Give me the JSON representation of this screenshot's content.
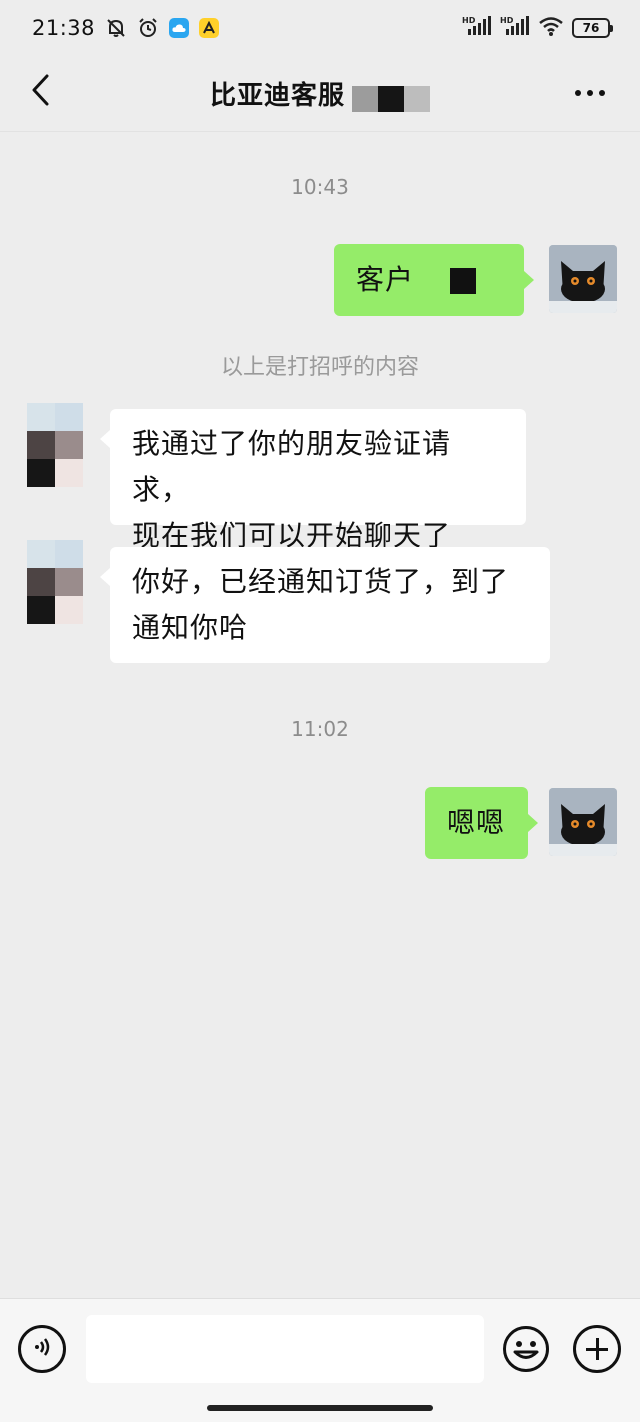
{
  "status_bar": {
    "time": "21:38",
    "left_icons": [
      "mute-bell-icon",
      "alarm-icon",
      "cloud-app-icon",
      "yellow-app-icon"
    ],
    "right_icons": [
      "hd-signal-1-icon",
      "hd-signal-2-icon",
      "wifi-icon"
    ],
    "battery": "76"
  },
  "nav": {
    "title": "比亚迪客服",
    "back_icon": "chevron-left-icon",
    "more_icon": "more-dots-icon"
  },
  "messages": [
    {
      "type": "timestamp",
      "text": "10:43"
    },
    {
      "type": "outgoing",
      "text": "客户"
    },
    {
      "type": "system",
      "text": "以上是打招呼的内容"
    },
    {
      "type": "incoming",
      "lines": [
        "我通过了你的朋友验证请求，",
        "现在我们可以开始聊天了"
      ]
    },
    {
      "type": "incoming",
      "lines": [
        "你好，已经通知订货了，到了",
        "通知你哈"
      ]
    },
    {
      "type": "timestamp",
      "text": "11:02"
    },
    {
      "type": "outgoing",
      "text": "嗯嗯"
    }
  ],
  "input_bar": {
    "voice_icon": "voice-icon",
    "input_value": "",
    "emoji_icon": "emoji-icon",
    "plus_icon": "plus-icon"
  },
  "colors": {
    "background": "#ededed",
    "outgoing_bubble": "#95ec69",
    "incoming_bubble": "#ffffff",
    "timestamp": "#8c8c8c"
  }
}
